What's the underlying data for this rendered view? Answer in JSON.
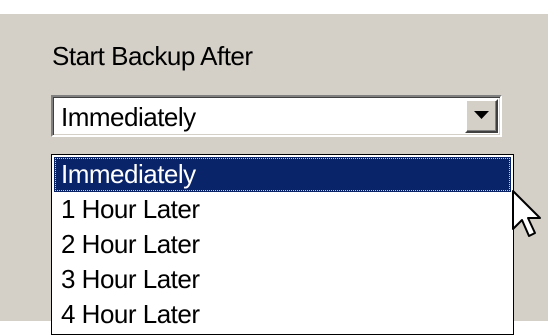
{
  "group": {
    "label": "Start Backup After"
  },
  "combo": {
    "value": "Immediately",
    "button_icon": "chevron-down-icon"
  },
  "dropdown": {
    "options": [
      "Immediately",
      "1 Hour Later",
      "2 Hour Later",
      "3 Hour Later",
      "4 Hour Later"
    ],
    "selected_index": 0
  },
  "colors": {
    "dialog_background": "#d4d0c8",
    "selection_highlight": "#0a246a",
    "selection_text": "#ffffff"
  }
}
